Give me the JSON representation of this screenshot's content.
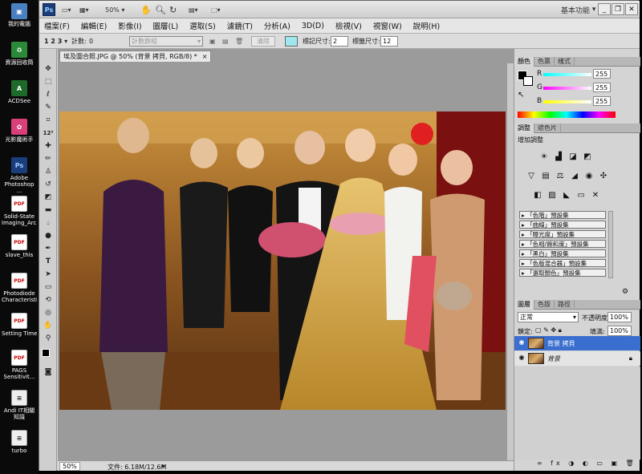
{
  "desktop": {
    "icons": [
      {
        "label": "我的電腦",
        "icon": "computer-icon"
      },
      {
        "label": "資源回收筒",
        "icon": "recycle-bin-icon"
      },
      {
        "label": "ACDSee",
        "icon": "acdsee-icon"
      },
      {
        "label": "光影魔術手",
        "icon": "photo-app-icon"
      },
      {
        "label": "Adobe Photoshop ...",
        "icon": "photoshop-icon"
      },
      {
        "label": "Solid-State Imaging_Arc...",
        "icon": "pdf-icon"
      },
      {
        "label": "slave_this",
        "icon": "pdf-icon"
      },
      {
        "label": "Photodiode Characteristi...",
        "icon": "pdf-icon"
      },
      {
        "label": "Setting Time",
        "icon": "pdf-icon"
      },
      {
        "label": "PAGS Sensitivit...",
        "icon": "pdf-icon"
      },
      {
        "label": "Andi IT相關 知識",
        "icon": "document-icon"
      },
      {
        "label": "turbo",
        "icon": "document-icon"
      }
    ]
  },
  "appbar": {
    "logo": "Ps",
    "zoom": "50%",
    "workspace": "基本功能"
  },
  "menus": [
    "檔案(F)",
    "編輯(E)",
    "影像(I)",
    "圖層(L)",
    "選取(S)",
    "濾鏡(T)",
    "分析(A)",
    "3D(D)",
    "檢視(V)",
    "視窗(W)",
    "說明(H)"
  ],
  "options": {
    "tool_glyph": "1 2 3",
    "count_label": "計數:",
    "count_value": "0",
    "group_placeholder": "計數群組",
    "clear_label": "清除",
    "marker_size_label": "標記尺寸:",
    "marker_size_value": "2",
    "label_size_label": "標籤尺寸:",
    "label_size_value": "12"
  },
  "document": {
    "tab_title": "埃及圍合照.JPG @ 50% (背景 拷貝, RGB/8) *",
    "close": "×",
    "status_zoom": "50%",
    "status_doc": "文件: 6.18M/12.6M"
  },
  "colors": {
    "canvas_bg": "#9b9b9b",
    "layer_selected": "#3a6fcf",
    "accent_swatch": "#9fe7ef"
  },
  "color_panel": {
    "tabs": [
      "顏色",
      "色票",
      "樣式"
    ],
    "r_label": "R",
    "r_value": "255",
    "g_label": "G",
    "g_value": "255",
    "b_label": "B",
    "b_value": "255"
  },
  "adjust_panel": {
    "tabs": [
      "調整",
      "遮色片"
    ],
    "title": "增加調整",
    "presets": [
      "「色階」預設集",
      "「曲線」預設集",
      "「曝光度」預設集",
      "「色相/飽和度」預設集",
      "「黑白」預設集",
      "「色版混合器」預設集",
      "「選取顏色」預設集"
    ]
  },
  "layers_panel": {
    "tabs": [
      "圖層",
      "色版",
      "路徑"
    ],
    "blend_mode": "正常",
    "opacity_label": "不透明度:",
    "opacity_value": "100%",
    "lock_label": "鎖定:",
    "fill_label": "填滿:",
    "fill_value": "100%",
    "layers": [
      {
        "name": "背景 拷貝",
        "selected": true
      },
      {
        "name": "背景",
        "selected": false
      }
    ]
  }
}
